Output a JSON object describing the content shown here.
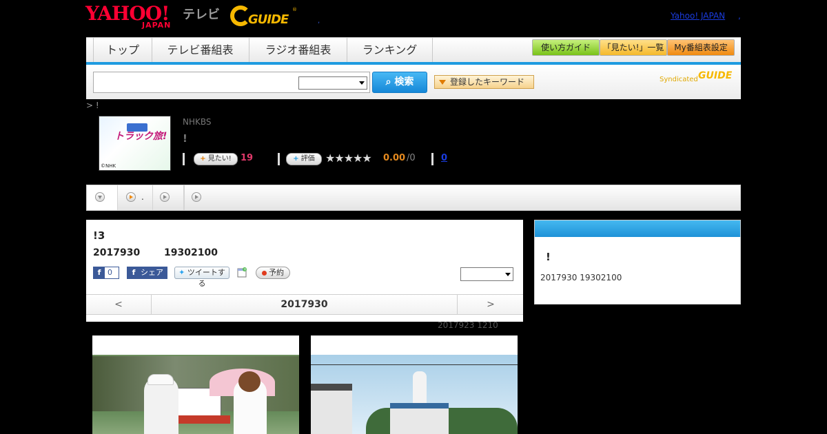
{
  "header": {
    "yahoo_logo_main": "YAHOO!",
    "yahoo_logo_sub": "JAPAN",
    "tv_label": "テレビ",
    "gguide_logo": "GUIDE",
    "gguide_mark": "®",
    "dot1": ",",
    "yahoo_japan_link": "Yahoo! JAPAN",
    "dot2": ","
  },
  "nav": {
    "tabs": [
      {
        "label": "トップ"
      },
      {
        "label": "テレビ番組表"
      },
      {
        "label": "ラジオ番組表"
      },
      {
        "label": "ランキング"
      }
    ],
    "pills": {
      "guide": "使い方ガイド",
      "mitai": "「見たい!」一覧",
      "my": "My番組表設定"
    }
  },
  "search": {
    "placeholder": "",
    "button": "検索",
    "keyword_button": "登録したキーワード",
    "syndicated": "Syndicated",
    "syndicated_logo": "GUIDE"
  },
  "breadcrumb": "> !",
  "program": {
    "thumb_text": "トラック旅!",
    "thumb_credit": "©NHK",
    "channel": "NHKBS",
    "title": "!",
    "mitai_label": "見たい!",
    "mitai_count": "19",
    "hyouka_label": "評価",
    "stars": "★★★★★",
    "rating": "0.00",
    "rating_max": "/0",
    "review_link": "0",
    "tab_dot": "."
  },
  "episode": {
    "title": "!3",
    "date": "2017930",
    "time": "19302100",
    "fb_like_count": "0",
    "fb_like_f": "f",
    "fb_share_f": "f",
    "fb_share": "シェア",
    "tweet": "ツイートする",
    "yoyaku": "予約",
    "prev": "<",
    "next": ">",
    "nav_date": "2017930",
    "update_note": "2017923  1210"
  },
  "side": {
    "title": "!",
    "info": "2017930  19302100"
  },
  "colors": {
    "accent_blue": "#1e9be0",
    "yahoo_red": "#ff0033",
    "gguide_yellow": "#f6b800",
    "mitai_pink": "#e0396a",
    "rating_orange": "#e58a1f"
  }
}
